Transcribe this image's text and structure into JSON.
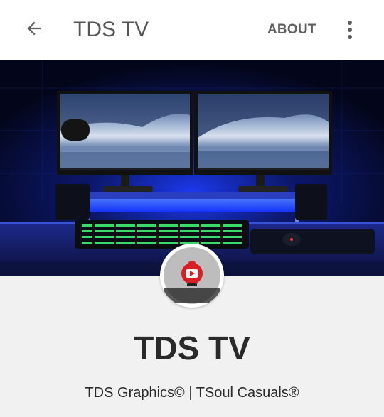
{
  "appbar": {
    "back_icon": "arrow-back-icon",
    "title": "TDS TV",
    "about_label": "ABOUT",
    "more_icon": "more-vert-icon"
  },
  "banner": {
    "description_icon": "desk-setup-banner-image"
  },
  "channel": {
    "avatar_icon": "channel-avatar-icon",
    "name": "TDS TV",
    "description": "TDS Graphics© | TSoul Casuals®"
  },
  "colors": {
    "appbar_bg": "#ffffff",
    "title_text": "#555555",
    "page_bg": "#f1f1f1",
    "name_text": "#2a2a2a",
    "banner_blue": "#1a3cff"
  }
}
